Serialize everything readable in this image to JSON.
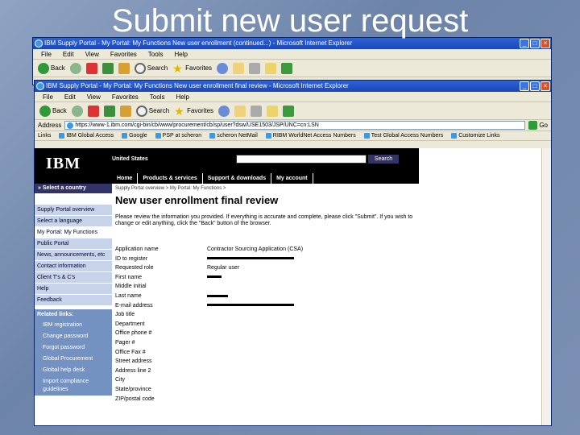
{
  "slide": {
    "title": "Submit new user request"
  },
  "back_window": {
    "title": "IBM Supply Portal - My Portal: My Functions New user enrollment (continued...) - Microsoft Internet Explorer",
    "menu": [
      "File",
      "Edit",
      "View",
      "Favorites",
      "Tools",
      "Help"
    ],
    "toolbar": {
      "back": "Back",
      "search": "Search",
      "favorites": "Favorites"
    }
  },
  "front_window": {
    "title": "IBM Supply Portal - My Portal: My Functions New user enrollment final review - Microsoft Internet Explorer",
    "menu": [
      "File",
      "Edit",
      "View",
      "Favorites",
      "Tools",
      "Help"
    ],
    "toolbar": {
      "back": "Back",
      "search": "Search",
      "favorites": "Favorites"
    },
    "address_label": "Address",
    "address_value": "https://www-1.ibm.com/cgi-bin/cb/www/procurement/cb/sp/user?dsw/USE1503/JSP/UNC=cn:LSN",
    "go_label": "Go",
    "links_label": "Links",
    "links": [
      "IBM Global Access",
      "Google",
      "PSP at scheron",
      "scheron NetMail",
      "RIBM WorldNet Access Numbers",
      "Test Global Access Numbers",
      "Customize Links"
    ]
  },
  "page": {
    "country": "United States",
    "search_button": "Search",
    "nav": [
      "Home",
      "Products & services",
      "Support & downloads",
      "My account"
    ],
    "select_country": "» Select a country",
    "left_nav": [
      "Supply Portal overview",
      "Select a language",
      "My Portal: My Functions",
      "Public Portal",
      "News, announcements, etc",
      "Contact information",
      "Client T's & C's",
      "Help",
      "Feedback"
    ],
    "related_heading": "Related links:",
    "related_links": [
      "IBM registration",
      "Change password",
      "Forgot password",
      "Global Procurement",
      "Global help desk",
      "Import compliance guidelines"
    ],
    "breadcrumb": "Supply Portal overview  >  My Portal: My Functions  >",
    "title": "New user enrollment final review",
    "intro": "Please review the information you provided. If everything is accurate and complete, please click \"Submit\". If you wish to change or edit anything, click the \"Back\" button of the browser.",
    "fields": [
      {
        "label": "Application name",
        "value": "Contractor Sourcing Application (CSA)"
      },
      {
        "label": "ID to register",
        "value": ""
      },
      {
        "label": "Requested role",
        "value": "Regular user"
      },
      {
        "label": "First name",
        "value": ""
      },
      {
        "label": "Middle initial",
        "value": ""
      },
      {
        "label": "Last name",
        "value": ""
      },
      {
        "label": "E-mail address",
        "value": ""
      },
      {
        "label": "Job title",
        "value": ""
      },
      {
        "label": "Department",
        "value": ""
      },
      {
        "label": "Office phone #",
        "value": ""
      },
      {
        "label": "Pager #",
        "value": ""
      },
      {
        "label": "Office Fax #",
        "value": ""
      },
      {
        "label": "Street address",
        "value": ""
      },
      {
        "label": "Address line 2",
        "value": ""
      },
      {
        "label": "City",
        "value": ""
      },
      {
        "label": "State/province",
        "value": ""
      },
      {
        "label": "ZIP/postal code",
        "value": ""
      }
    ]
  }
}
